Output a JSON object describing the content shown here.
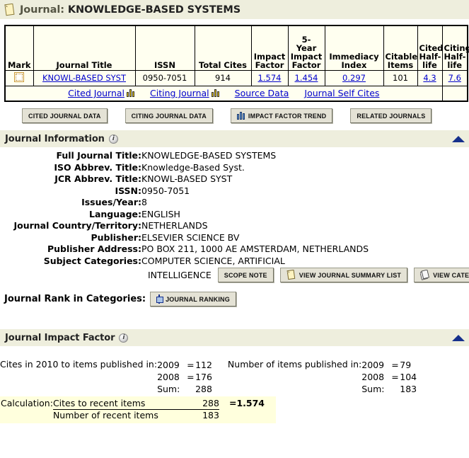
{
  "header": {
    "icon": "journal-book-icon",
    "prefix": "Journal:",
    "journal_name": "KNOWLEDGE-BASED SYSTEMS"
  },
  "summary_table": {
    "columns": [
      "Mark",
      "Journal Title",
      "ISSN",
      "Total Cites",
      "Impact Factor",
      "5-Year Impact Factor",
      "Immediacy Index",
      "Citable Items",
      "Cited Half-life",
      "Citing Half-life"
    ],
    "columns_wrapped": [
      "Mark",
      "Journal Title",
      "ISSN",
      "Total Cites",
      [
        "Impact",
        "Factor"
      ],
      [
        "5-",
        "Year",
        "Impact",
        "Factor"
      ],
      [
        "Immediacy",
        "Index"
      ],
      [
        "Citable",
        "Items"
      ],
      [
        "Cited",
        "Half-",
        "life"
      ],
      [
        "Citing",
        "Half-",
        "life"
      ]
    ],
    "row": {
      "mark_checked": false,
      "journal_title": "KNOWL-BASED SYST",
      "issn": "0950-7051",
      "total_cites": "914",
      "impact_factor": "1.574",
      "five_year_impact_factor": "1.454",
      "immediacy_index": "0.297",
      "citable_items": "101",
      "cited_half_life": "4.3",
      "citing_half_life": "7.6"
    },
    "footer_links": [
      {
        "label": "Cited Journal",
        "icon": "bar-chart-icon"
      },
      {
        "label": "Citing Journal",
        "icon": "bar-chart-icon"
      },
      {
        "label": "Source Data",
        "icon": ""
      },
      {
        "label": "Journal Self Cites",
        "icon": ""
      }
    ]
  },
  "action_buttons": [
    {
      "label": "CITED JOURNAL DATA",
      "icon": ""
    },
    {
      "label": "CITING JOURNAL DATA",
      "icon": ""
    },
    {
      "label": "IMPACT FACTOR TREND",
      "icon": "bar-chart-icon"
    },
    {
      "label": "RELATED JOURNALS",
      "icon": ""
    }
  ],
  "journal_information": {
    "section_title": "Journal Information",
    "fields": [
      {
        "label": "Full Journal Title:",
        "value": "KNOWLEDGE-BASED SYSTEMS"
      },
      {
        "label": "ISO Abbrev. Title:",
        "value": "Knowledge-Based Syst."
      },
      {
        "label": "JCR Abbrev. Title:",
        "value": "KNOWL-BASED SYST"
      },
      {
        "label": "ISSN:",
        "value": "0950-7051"
      },
      {
        "label": "Issues/Year:",
        "value": "8"
      },
      {
        "label": "Language:",
        "value": "ENGLISH"
      },
      {
        "label": "Journal Country/Territory:",
        "value": "NETHERLANDS"
      },
      {
        "label": "Publisher:",
        "value": "ELSEVIER SCIENCE BV"
      },
      {
        "label": "Publisher Address:",
        "value": "PO BOX 211, 1000 AE AMSTERDAM, NETHERLANDS"
      },
      {
        "label": "Subject Categories:",
        "value": "COMPUTER SCIENCE, ARTIFICIAL"
      }
    ],
    "subject_category_line2": "INTELLIGENCE",
    "category_buttons": [
      {
        "label": "SCOPE NOTE",
        "icon": ""
      },
      {
        "label": "VIEW JOURNAL SUMMARY LIST",
        "icon": "journal-book-icon"
      },
      {
        "label": "VIEW CATEGORY DATA",
        "icon": "journals-stack-icon"
      }
    ]
  },
  "journal_rank": {
    "label": "Journal Rank in Categories:",
    "button": {
      "label": "JOURNAL RANKING",
      "icon": "ranking-icon"
    }
  },
  "journal_impact_factor": {
    "section_title": "Journal Impact Factor",
    "cites_lead": "Cites in 2010 to items published in:",
    "cites": [
      {
        "year": "2009",
        "eq": "=",
        "value": "112"
      },
      {
        "year": "2008",
        "eq": "=",
        "value": "176"
      },
      {
        "year": "Sum:",
        "eq": "",
        "value": "288"
      }
    ],
    "items_lead": "Number of items published in:",
    "items": [
      {
        "year": "2009",
        "eq": "=",
        "value": "79"
      },
      {
        "year": "2008",
        "eq": "=",
        "value": "104"
      },
      {
        "year": "Sum:",
        "eq": "",
        "value": "183"
      }
    ],
    "calculation": {
      "label": "Calculation:",
      "numerator_text": "Cites to recent items",
      "numerator_value": "288",
      "denominator_text": "Number of recent items",
      "denominator_value": "183",
      "equals": "=",
      "result": "1.574"
    }
  },
  "colors": {
    "header_bg": "#eeeedd",
    "table_bg": "#fffff0",
    "link": "#0000cc",
    "triangle": "#16308c",
    "calc_highlight": "#ffffdd",
    "button_bg": "#e4e2d5"
  }
}
